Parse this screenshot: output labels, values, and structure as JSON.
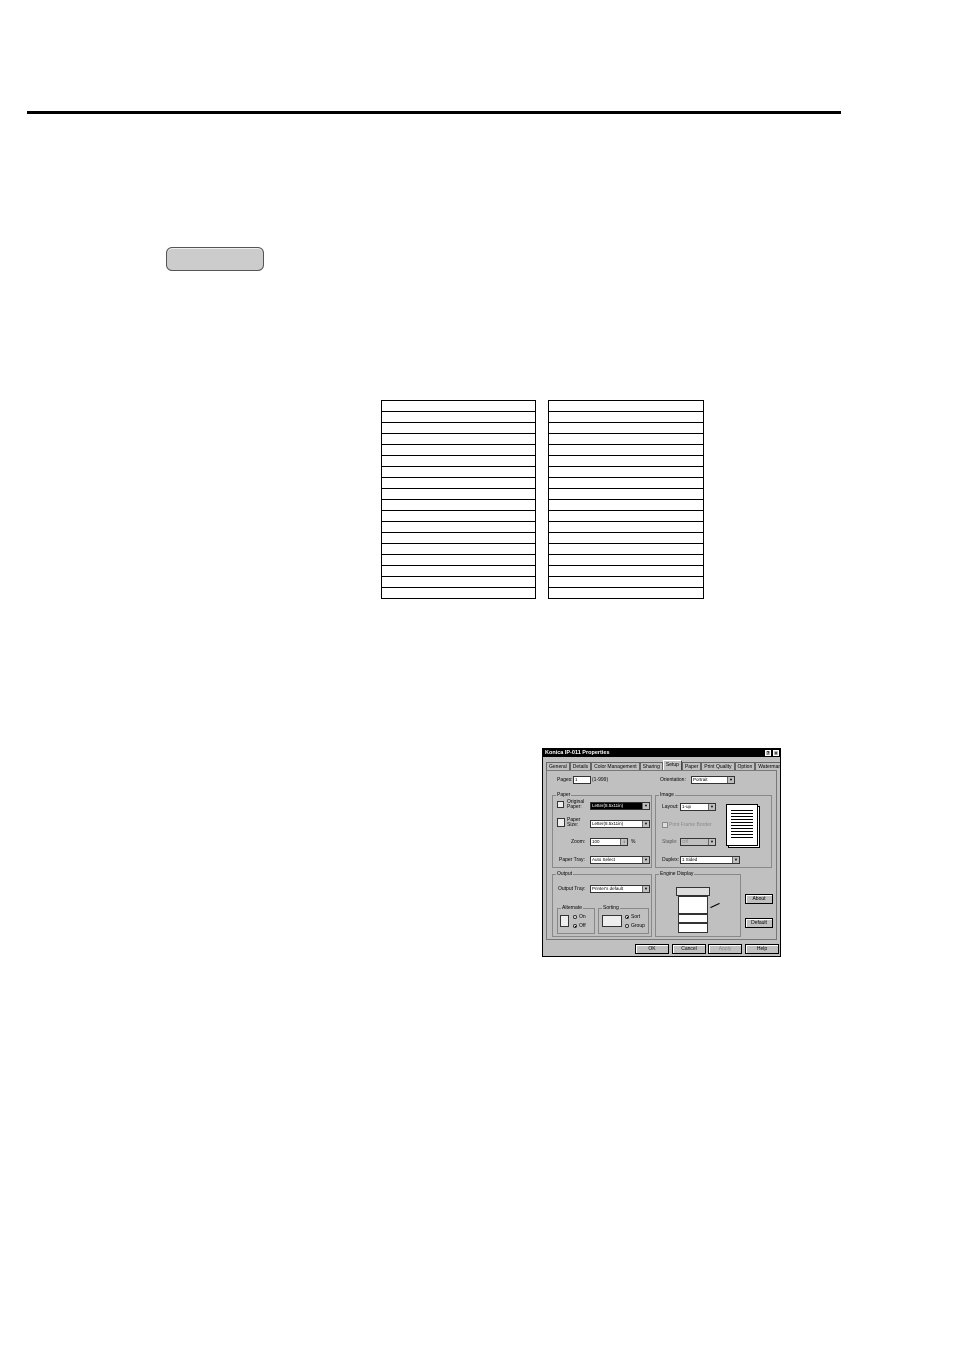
{
  "dialog": {
    "title": "Konica IP-011 Properties",
    "title_buttons": [
      "?",
      "×"
    ],
    "tabs": [
      "General",
      "Details",
      "Color Management",
      "Sharing",
      "Setup",
      "Paper",
      "Print Quality",
      "Option",
      "Watermark"
    ],
    "active_tab": "Setup",
    "pages_label": "Pages:",
    "pages_value": "1",
    "pages_range": "(1-999)",
    "orientation_label": "Orientation:",
    "orientation_value": "Portrait",
    "paper_group": "Paper",
    "original_paper_label": "Original Paper:",
    "original_paper_value": "Letter(8.5x11in)",
    "paper_size_label": "Paper Size:",
    "paper_size_value": "Letter(8.5x11in)",
    "zoom_label": "Zoom:",
    "zoom_value": "100",
    "zoom_unit": "%",
    "paper_tray_label": "Paper Tray:",
    "paper_tray_value": "Auto Select",
    "image_group": "Image",
    "layout_label": "Layout:",
    "layout_value": "1-up",
    "print_frame_label": "Print Frame Border",
    "staple_label": "Staple:",
    "staple_value": "Off",
    "duplex_label": "Duplex:",
    "duplex_value": "1 Sided",
    "output_group": "Output",
    "output_tray_label": "Output Tray:",
    "output_tray_value": "Printer's default",
    "alternate_group": "Alternate",
    "alt_on": "On",
    "alt_off": "Off",
    "sorting_group": "Sorting",
    "sort_label": "Sort",
    "group_label": "Group",
    "engine_group": "Engine Display",
    "about_btn": "About",
    "default_btn": "Default",
    "ok_btn": "OK",
    "cancel_btn": "Cancel",
    "apply_btn": "Apply",
    "help_btn": "Help"
  }
}
